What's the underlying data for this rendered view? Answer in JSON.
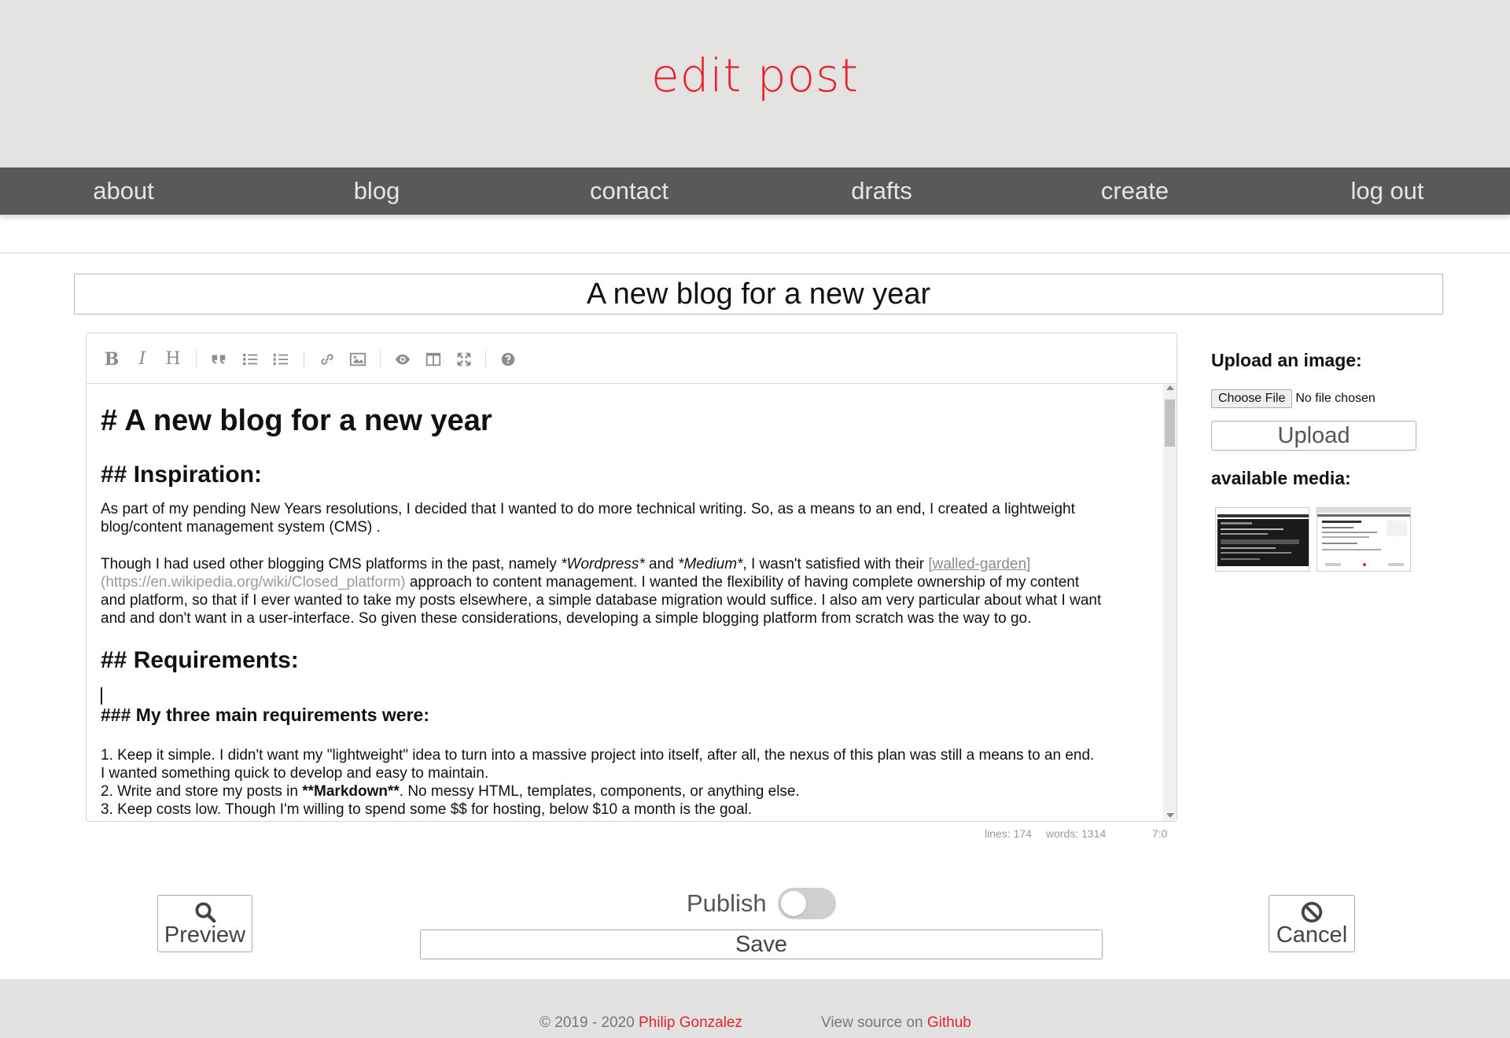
{
  "header": {
    "title": "edit post"
  },
  "nav": {
    "items": [
      {
        "label": "about"
      },
      {
        "label": "blog"
      },
      {
        "label": "contact"
      },
      {
        "label": "drafts"
      },
      {
        "label": "create"
      },
      {
        "label": "log out"
      }
    ]
  },
  "post": {
    "title_value": "A new blog for a new year"
  },
  "toolbar": {
    "bold": "B",
    "italic": "I",
    "heading": "H",
    "icons": [
      "quote-icon",
      "unordered-list-icon",
      "ordered-list-icon",
      "link-icon",
      "image-icon",
      "preview-icon",
      "side-by-side-icon",
      "fullscreen-icon",
      "help-icon"
    ]
  },
  "editor": {
    "h1": "# A new blog for a new year",
    "h2_inspiration": "## Inspiration:",
    "p1_line1": "As part of my pending New Years resolutions, I decided that I wanted to do more technical writing.  So, as a means to an end, I created a lightweight",
    "p1_line2": "blog/content management system (CMS) .",
    "p2_a": "Though I had used other blogging CMS platforms in the past, namely ",
    "p2_wordpress": "*Wordpress*",
    "p2_and": " and ",
    "p2_medium": "*Medium*",
    "p2_b": ", I wasn't satisfied with their ",
    "p2_link": "[walled-garden]",
    "p2_url": "(https://en.wikipedia.org/wiki/Closed_platform)",
    "p2_c": " approach to content management. I wanted the flexibility of having complete ownership of my content",
    "p2_line3": "and platform, so that if I ever wanted to take my posts elsewhere, a simple database migration would suffice.  I also am very particular about what I want",
    "p2_line4": "and and don't want in a user-interface.  So given these considerations, developing a simple blogging platform from scratch was the way to go.",
    "h2_requirements": "## Requirements:",
    "h3_main": "### My three main requirements were:",
    "li1_line1": "1.  Keep it simple.  I didn't want my \"lightweight\" idea to turn into a massive project into itself, after all, the nexus of this plan was still a means to an end.",
    "li1_line2": "I wanted something quick to develop and easy to maintain.",
    "li2_a": "2.  Write and store my posts in ",
    "li2_bold": "**Markdown**",
    "li2_b": ".  No messy HTML, templates, components, or anything else.",
    "li3": "3.  Keep costs low.  Though I'm willing to spend some $$ for hosting, below $10 a month is the goal."
  },
  "status": {
    "lines": "lines: 174",
    "words": "words: 1314",
    "cursor": "7:0"
  },
  "upload": {
    "heading": "Upload an image:",
    "choose_label": "Choose File",
    "file_status": "No file chosen",
    "upload_label": "Upload",
    "media_heading": "available media:"
  },
  "actions": {
    "preview_label": "Preview",
    "publish_label": "Publish",
    "publish_on": false,
    "save_label": "Save",
    "cancel_label": "Cancel"
  },
  "footer": {
    "copyright": "© 2019 - 2020 ",
    "author": "Philip Gonzalez",
    "source_text": "View source on ",
    "source_link": "Github"
  },
  "colors": {
    "accent": "#e8202a",
    "nav_bg": "#595959",
    "header_bg": "#e4e3e2",
    "footer_bg": "#e2e2e2"
  }
}
